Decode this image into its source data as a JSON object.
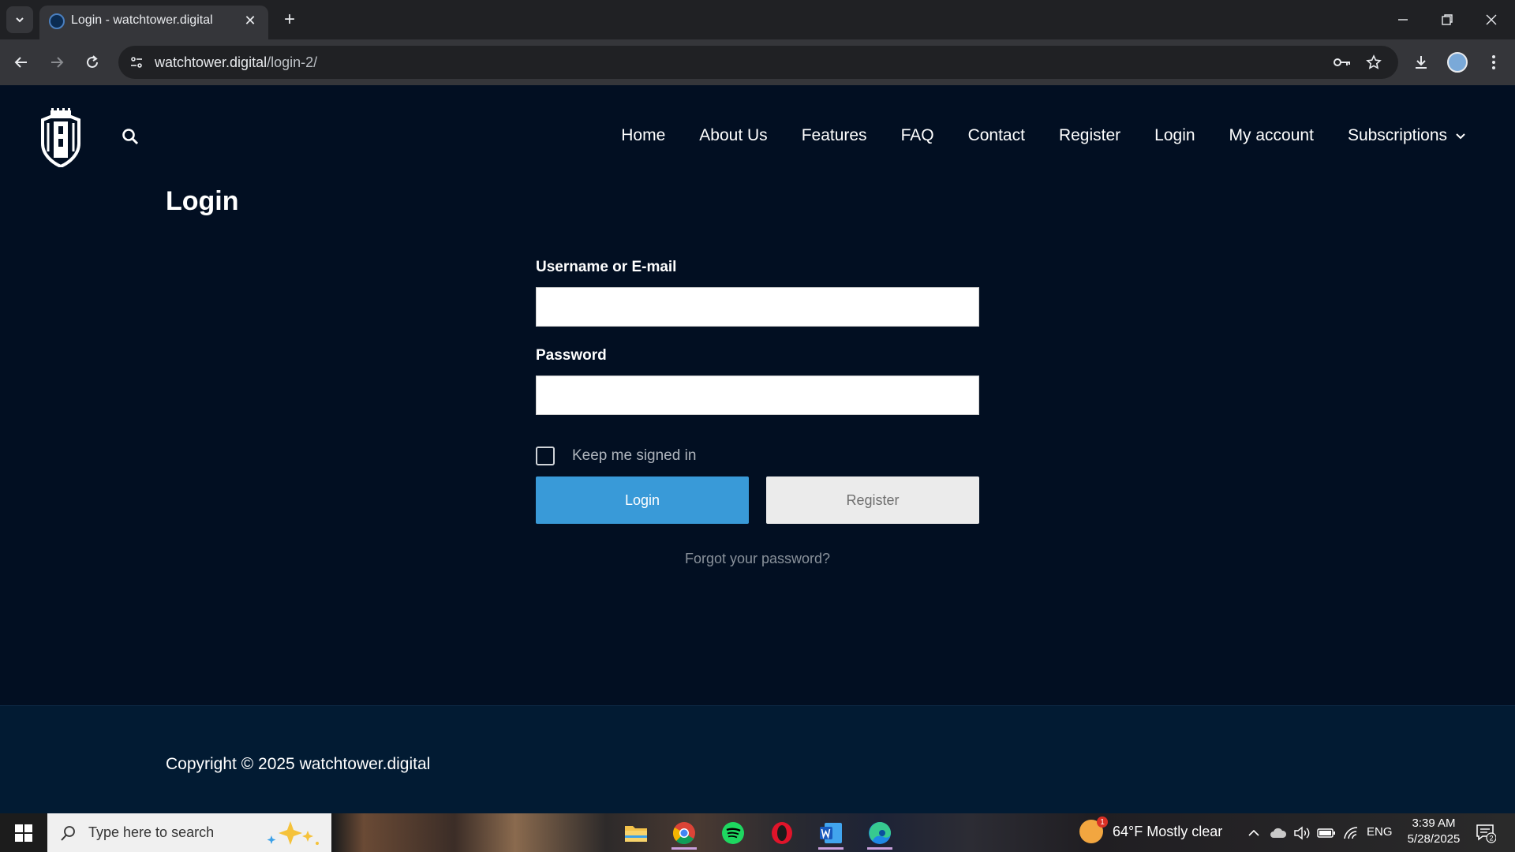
{
  "browser": {
    "tab_title": "Login - watchtower.digital",
    "url_host": "watchtower.digital",
    "url_path": "/login-2/"
  },
  "header": {
    "nav": [
      "Home",
      "About Us",
      "Features",
      "FAQ",
      "Contact",
      "Register",
      "Login",
      "My account",
      "Subscriptions"
    ]
  },
  "main": {
    "title": "Login",
    "form": {
      "username_label": "Username or E-mail",
      "username_value": "",
      "password_label": "Password",
      "password_value": "",
      "remember_label": "Keep me signed in",
      "remember_checked": false,
      "login_button": "Login",
      "register_button": "Register",
      "forgot_link": "Forgot your password?"
    }
  },
  "footer": {
    "copyright": "Copyright © 2025 watchtower.digital"
  },
  "taskbar": {
    "search_placeholder": "Type here to search",
    "weather_temp": "64°F",
    "weather_desc": "Mostly clear",
    "weather_badge": "1",
    "language": "ENG",
    "time": "3:39 AM",
    "date": "5/28/2025",
    "notification_count": "2"
  },
  "colors": {
    "page_bg": "#020f22",
    "footer_bg": "#021b33",
    "login_button": "#399ad8",
    "register_button": "#ebebeb"
  }
}
